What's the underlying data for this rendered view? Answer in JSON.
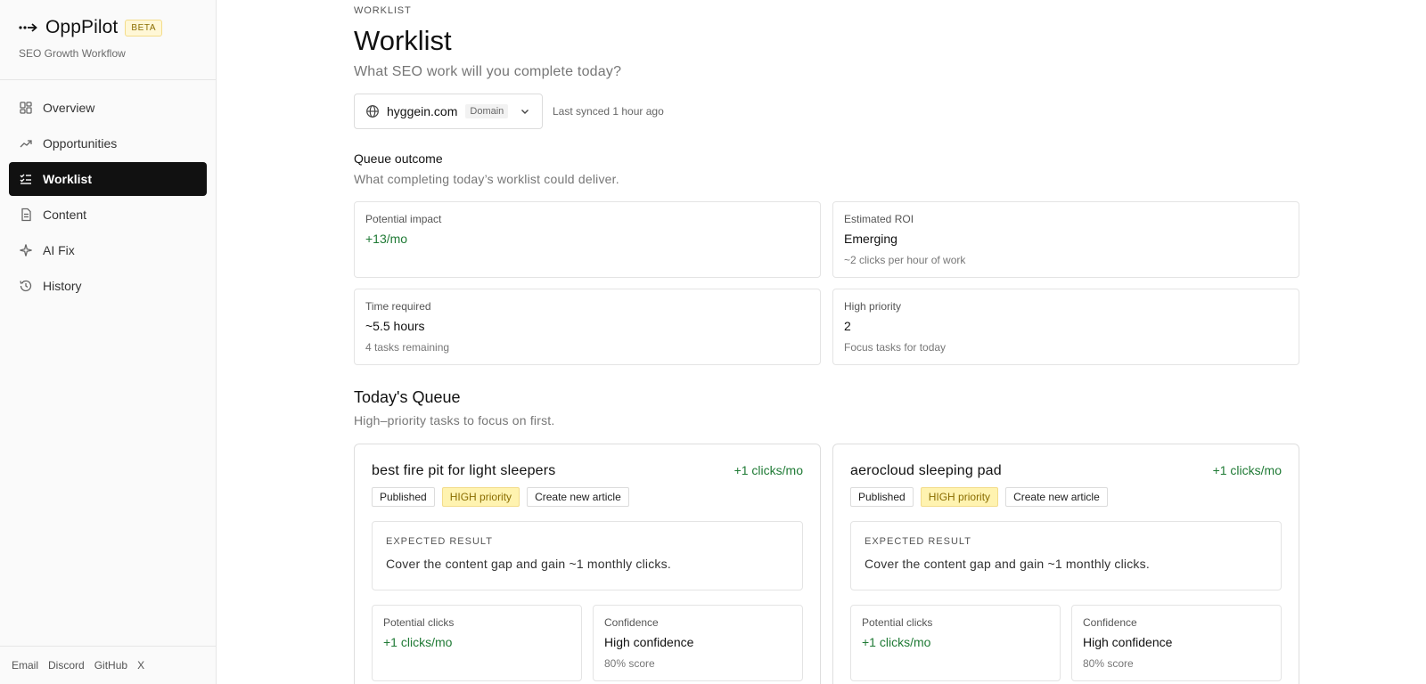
{
  "brand": {
    "name": "OppPilot",
    "beta": "BETA",
    "subtitle": "SEO Growth Workflow"
  },
  "nav": [
    {
      "label": "Overview",
      "icon": "grid-icon",
      "active": false
    },
    {
      "label": "Opportunities",
      "icon": "trending-up-icon",
      "active": false
    },
    {
      "label": "Worklist",
      "icon": "list-check-icon",
      "active": true
    },
    {
      "label": "Content",
      "icon": "document-icon",
      "active": false
    },
    {
      "label": "AI Fix",
      "icon": "sparkle-icon",
      "active": false
    },
    {
      "label": "History",
      "icon": "history-icon",
      "active": false
    }
  ],
  "footer": {
    "links": [
      "Email",
      "Discord",
      "GitHub",
      "X"
    ]
  },
  "header": {
    "eyebrow": "WORKLIST",
    "title": "Worklist",
    "subtitle": "What SEO work will you complete today?"
  },
  "domain": {
    "name": "hyggein.com",
    "tag": "Domain",
    "synced": "Last synced 1 hour ago"
  },
  "outcome": {
    "title": "Queue outcome",
    "subtitle": "What completing today’s worklist could deliver.",
    "stats": [
      {
        "label": "Potential impact",
        "value": "+13/mo",
        "note": ""
      },
      {
        "label": "Estimated ROI",
        "value": "Emerging",
        "note": "~2 clicks per hour of work"
      },
      {
        "label": "Time required",
        "value": "~5.5 hours",
        "note": "4 tasks remaining"
      },
      {
        "label": "High priority",
        "value": "2",
        "note": "Focus tasks for today"
      }
    ]
  },
  "queue": {
    "title": "Today's Queue",
    "subtitle": "High–priority tasks to focus on first.",
    "tasks": [
      {
        "title": "best fire pit for light sleepers",
        "clicks": "+1 clicks/mo",
        "status": "Published",
        "priority": "HIGH priority",
        "action": "Create new article",
        "expected_label": "EXPECTED RESULT",
        "expected_text": "Cover the content gap and gain ~1 monthly clicks.",
        "potential_label": "Potential clicks",
        "potential_value": "+1 clicks/mo",
        "confidence_label": "Confidence",
        "confidence_value": "High confidence",
        "confidence_note": "80% score"
      },
      {
        "title": "aerocloud sleeping pad",
        "clicks": "+1 clicks/mo",
        "status": "Published",
        "priority": "HIGH priority",
        "action": "Create new article",
        "expected_label": "EXPECTED RESULT",
        "expected_text": "Cover the content gap and gain ~1 monthly clicks.",
        "potential_label": "Potential clicks",
        "potential_value": "+1 clicks/mo",
        "confidence_label": "Confidence",
        "confidence_value": "High confidence",
        "confidence_note": "80% score"
      }
    ]
  },
  "colors": {
    "accent_green": "#1f7a35",
    "active_nav_bg": "#111111",
    "high_badge_bg": "#fff3b0"
  }
}
